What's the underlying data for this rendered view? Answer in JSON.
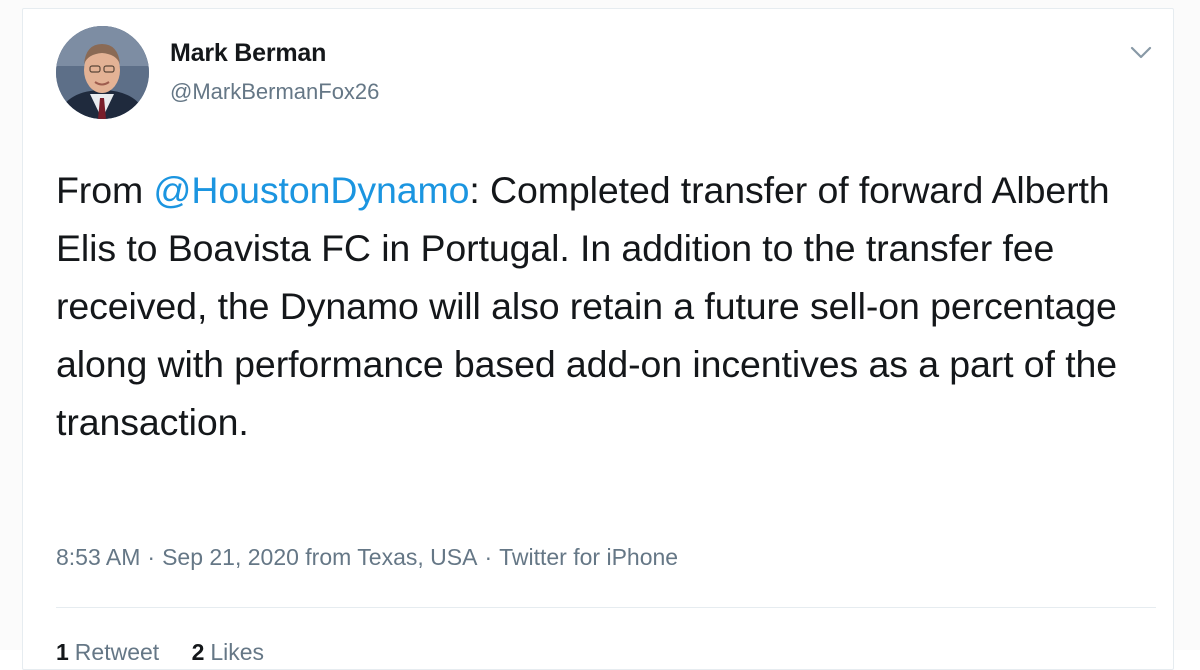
{
  "tweet": {
    "display_name": "Mark Berman",
    "handle": "@MarkBermanFox26",
    "text_prefix": "From ",
    "mention": "@HoustonDynamo",
    "text_body": ": Completed transfer of forward Alberth Elis to Boavista FC in Portugal. In addition to the transfer fee received, the Dynamo will also retain a future sell-on percentage along with performance based add-on incentives as a part of the transaction.",
    "time": "8:53 AM",
    "date": "Sep 21, 2020",
    "location": "from Texas, USA",
    "source": "Twitter for iPhone",
    "separator": "·"
  },
  "stats": {
    "retweets_count": "1",
    "retweets_label": "Retweet",
    "likes_count": "2",
    "likes_label": "Likes"
  },
  "icons": {
    "menu": "chevron-down-icon"
  },
  "colors": {
    "link": "#1b95e0",
    "text": "#14171a",
    "secondary": "#657786",
    "border": "#e6ecf0"
  }
}
